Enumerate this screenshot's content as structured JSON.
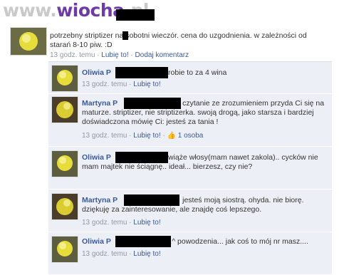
{
  "watermark": {
    "prefix": "www.",
    "brand": "wiocha",
    "suffix": ".pl"
  },
  "post": {
    "text": "potrzebny striptizer na sobotni wieczór. cena do uzgodnienia. w zależności od starań 8-10 piw. :D",
    "time": "13 godz. temu",
    "like": "Lubię to!",
    "add_comment": "Dodaj komentarz",
    "sep": " · "
  },
  "comments": [
    {
      "name": "Oliwia P",
      "text": "zrobie to za 4 wina",
      "time": "13 godz. temu",
      "like": "Lubię to!"
    },
    {
      "name": "Martyna P",
      "text": "czytanie ze zrozumieniem przyda Ci się na maturze. striptizer, nie striptizerka. swoją drogą, jako starsza i bardziej doświadczona mówię Ci: jesteś za tania !",
      "time": "13 godz. temu",
      "like": "Lubię to!",
      "likes_count": "1 osoba"
    },
    {
      "name": "Oliwia P",
      "text": "zwiąże włosy(mam nawet zakola).. cycków nie mam majtek nie ściągnę.. ideał... bierzesz, czy nie?",
      "time": "13 godz. temu",
      "like": "Lubię to!"
    },
    {
      "name": "Martyna P",
      "text": "jesteś moją siostrą. ohyda. nie biorę. dziękuję za zainteresowanie, ale znajdę coś lepszego.",
      "time": "13 godz. temu",
      "like": "Lubię to!"
    },
    {
      "name": "Oliwia P",
      "text": "-.^ powodzenia... jak coś to mój nr masz....",
      "time": "13 godz. temu",
      "like": "Lubię to!"
    }
  ],
  "colors": {
    "link": "#3b5998",
    "meta": "#9197a3",
    "comment_bg": "#eceff5",
    "redaction": "#000000"
  },
  "icons": {
    "like": "thumbs-up-icon"
  }
}
